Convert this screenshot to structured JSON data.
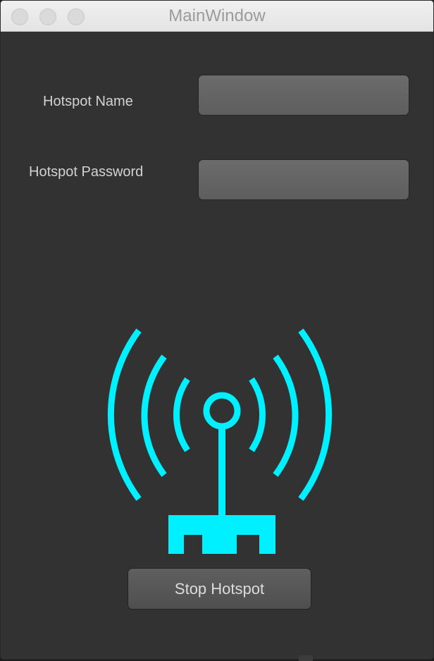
{
  "window": {
    "title": "MainWindow"
  },
  "form": {
    "name_label": "Hotspot Name",
    "name_value": "",
    "password_label": "Hotspot Password",
    "password_value": ""
  },
  "hotspot_icon": {
    "icon": "wifi-tower-icon",
    "color": "#00f0ff"
  },
  "actions": {
    "stop_label": "Stop Hotspot"
  }
}
